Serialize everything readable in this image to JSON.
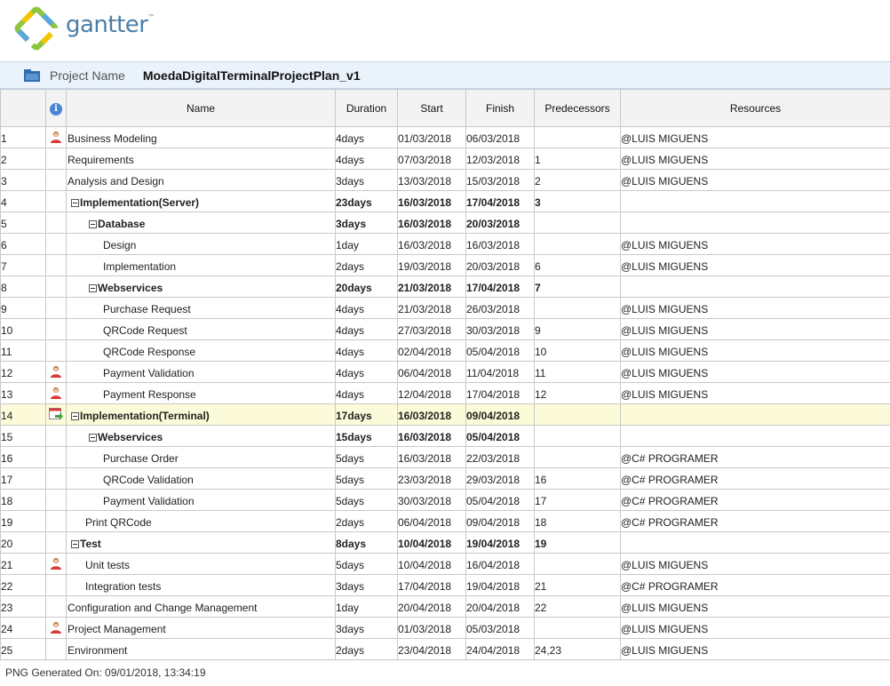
{
  "brand": {
    "name": "gantter",
    "tm": "™",
    "logo_icon": "gantter-logo-icon"
  },
  "project": {
    "label": "Project Name",
    "name": "MoedaDigitalTerminalProjectPlan_v1",
    "icon": "project-folder-icon"
  },
  "columns": {
    "id": "",
    "indicator": "info-icon",
    "name": "Name",
    "duration": "Duration",
    "start": "Start",
    "finish": "Finish",
    "predecessors": "Predecessors",
    "resources": "Resources"
  },
  "colors": {
    "accent": "#4a7ea8",
    "header_bg": "#f3f3f3",
    "highlight_row": "#fcfbd9",
    "projbar_bg": "#eaf2fb"
  },
  "tasks": [
    {
      "id": "1",
      "indicator": "person-icon",
      "level": 0,
      "summary": false,
      "name": "Business Modeling",
      "duration": "4days",
      "start": "01/03/2018",
      "finish": "06/03/2018",
      "predecessors": "",
      "resources": "@LUIS MIGUENS"
    },
    {
      "id": "2",
      "indicator": "",
      "level": 0,
      "summary": false,
      "name": "Requirements",
      "duration": "4days",
      "start": "07/03/2018",
      "finish": "12/03/2018",
      "predecessors": "1",
      "resources": "@LUIS MIGUENS"
    },
    {
      "id": "3",
      "indicator": "",
      "level": 0,
      "summary": false,
      "name": "Analysis and Design",
      "duration": "3days",
      "start": "13/03/2018",
      "finish": "15/03/2018",
      "predecessors": "2",
      "resources": "@LUIS MIGUENS"
    },
    {
      "id": "4",
      "indicator": "",
      "level": 0,
      "summary": true,
      "name": "Implementation(Server)",
      "duration": "23days",
      "start": "16/03/2018",
      "finish": "17/04/2018",
      "predecessors": "3",
      "resources": ""
    },
    {
      "id": "5",
      "indicator": "",
      "level": 1,
      "summary": true,
      "name": "Database",
      "duration": "3days",
      "start": "16/03/2018",
      "finish": "20/03/2018",
      "predecessors": "",
      "resources": ""
    },
    {
      "id": "6",
      "indicator": "",
      "level": 2,
      "summary": false,
      "name": "Design",
      "duration": "1day",
      "start": "16/03/2018",
      "finish": "16/03/2018",
      "predecessors": "",
      "resources": "@LUIS MIGUENS"
    },
    {
      "id": "7",
      "indicator": "",
      "level": 2,
      "summary": false,
      "name": "Implementation",
      "duration": "2days",
      "start": "19/03/2018",
      "finish": "20/03/2018",
      "predecessors": "6",
      "resources": "@LUIS MIGUENS"
    },
    {
      "id": "8",
      "indicator": "",
      "level": 1,
      "summary": true,
      "name": "Webservices",
      "duration": "20days",
      "start": "21/03/2018",
      "finish": "17/04/2018",
      "predecessors": "7",
      "resources": ""
    },
    {
      "id": "9",
      "indicator": "",
      "level": 2,
      "summary": false,
      "name": "Purchase Request",
      "duration": "4days",
      "start": "21/03/2018",
      "finish": "26/03/2018",
      "predecessors": "",
      "resources": "@LUIS MIGUENS"
    },
    {
      "id": "10",
      "indicator": "",
      "level": 2,
      "summary": false,
      "name": "QRCode Request",
      "duration": "4days",
      "start": "27/03/2018",
      "finish": "30/03/2018",
      "predecessors": "9",
      "resources": "@LUIS MIGUENS"
    },
    {
      "id": "11",
      "indicator": "",
      "level": 2,
      "summary": false,
      "name": "QRCode Response",
      "duration": "4days",
      "start": "02/04/2018",
      "finish": "05/04/2018",
      "predecessors": "10",
      "resources": "@LUIS MIGUENS"
    },
    {
      "id": "12",
      "indicator": "person-icon",
      "level": 2,
      "summary": false,
      "name": "Payment Validation",
      "duration": "4days",
      "start": "06/04/2018",
      "finish": "11/04/2018",
      "predecessors": "11",
      "resources": "@LUIS MIGUENS"
    },
    {
      "id": "13",
      "indicator": "person-icon",
      "level": 2,
      "summary": false,
      "name": "Payment Response",
      "duration": "4days",
      "start": "12/04/2018",
      "finish": "17/04/2018",
      "predecessors": "12",
      "resources": "@LUIS MIGUENS"
    },
    {
      "id": "14",
      "indicator": "calendar-constraint-icon",
      "level": 0,
      "summary": true,
      "highlight": true,
      "name": "Implementation(Terminal)",
      "duration": "17days",
      "start": "16/03/2018",
      "finish": "09/04/2018",
      "predecessors": "",
      "resources": ""
    },
    {
      "id": "15",
      "indicator": "",
      "level": 1,
      "summary": true,
      "name": "Webservices",
      "duration": "15days",
      "start": "16/03/2018",
      "finish": "05/04/2018",
      "predecessors": "",
      "resources": ""
    },
    {
      "id": "16",
      "indicator": "",
      "level": 2,
      "summary": false,
      "name": "Purchase Order",
      "duration": "5days",
      "start": "16/03/2018",
      "finish": "22/03/2018",
      "predecessors": "",
      "resources": "@C# PROGRAMER"
    },
    {
      "id": "17",
      "indicator": "",
      "level": 2,
      "summary": false,
      "name": "QRCode Validation",
      "duration": "5days",
      "start": "23/03/2018",
      "finish": "29/03/2018",
      "predecessors": "16",
      "resources": "@C# PROGRAMER"
    },
    {
      "id": "18",
      "indicator": "",
      "level": 2,
      "summary": false,
      "name": "Payment Validation",
      "duration": "5days",
      "start": "30/03/2018",
      "finish": "05/04/2018",
      "predecessors": "17",
      "resources": "@C# PROGRAMER"
    },
    {
      "id": "19",
      "indicator": "",
      "level": 1,
      "summary": false,
      "name": "Print QRCode",
      "duration": "2days",
      "start": "06/04/2018",
      "finish": "09/04/2018",
      "predecessors": "18",
      "resources": "@C# PROGRAMER"
    },
    {
      "id": "20",
      "indicator": "",
      "level": 0,
      "summary": true,
      "name": "Test",
      "duration": "8days",
      "start": "10/04/2018",
      "finish": "19/04/2018",
      "predecessors": "19",
      "resources": ""
    },
    {
      "id": "21",
      "indicator": "person-icon",
      "level": 1,
      "summary": false,
      "name": "Unit tests",
      "duration": "5days",
      "start": "10/04/2018",
      "finish": "16/04/2018",
      "predecessors": "",
      "resources": "@LUIS MIGUENS"
    },
    {
      "id": "22",
      "indicator": "",
      "level": 1,
      "summary": false,
      "name": "Integration tests",
      "duration": "3days",
      "start": "17/04/2018",
      "finish": "19/04/2018",
      "predecessors": "21",
      "resources": "@C# PROGRAMER"
    },
    {
      "id": "23",
      "indicator": "",
      "level": 0,
      "summary": false,
      "name": "Configuration and Change Management",
      "duration": "1day",
      "start": "20/04/2018",
      "finish": "20/04/2018",
      "predecessors": "22",
      "resources": "@LUIS MIGUENS"
    },
    {
      "id": "24",
      "indicator": "person-icon",
      "level": 0,
      "summary": false,
      "name": "Project Management",
      "duration": "3days",
      "start": "01/03/2018",
      "finish": "05/03/2018",
      "predecessors": "",
      "resources": "@LUIS MIGUENS"
    },
    {
      "id": "25",
      "indicator": "",
      "level": 0,
      "summary": false,
      "name": "Environment",
      "duration": "2days",
      "start": "23/04/2018",
      "finish": "24/04/2018",
      "predecessors": "24,23",
      "resources": "@LUIS MIGUENS"
    }
  ],
  "footer": {
    "text": "PNG Generated On: 09/01/2018, 13:34:19"
  }
}
